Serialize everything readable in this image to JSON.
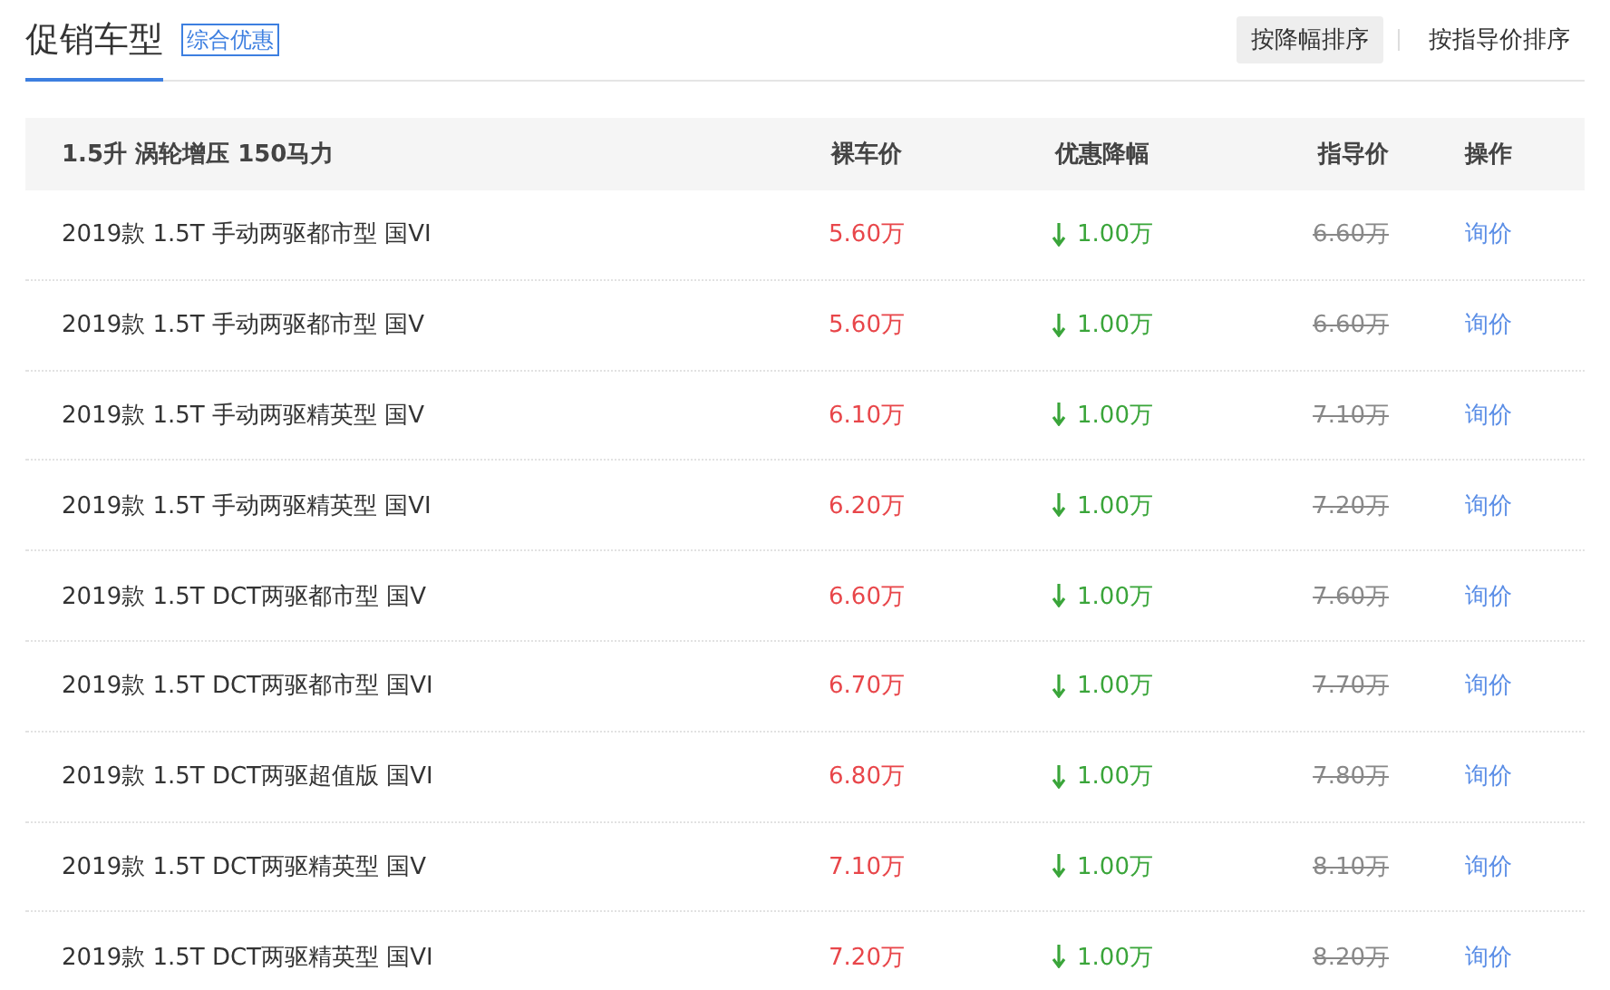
{
  "header": {
    "title": "促销车型",
    "tag": "综合优惠",
    "sort_buttons": [
      {
        "label": "按降幅排序",
        "selected": true
      },
      {
        "label": "按指导价排序",
        "selected": false
      }
    ]
  },
  "table": {
    "columns": [
      "1.5升 涡轮增压 150马力",
      "裸车价",
      "优惠降幅",
      "指导价",
      "操作"
    ],
    "rows": [
      {
        "name": "2019款 1.5T 手动两驱都市型 国VI",
        "price": "5.60万",
        "discount": "1.00万",
        "guide_price": "6.60万",
        "action": "询价"
      },
      {
        "name": "2019款 1.5T 手动两驱都市型 国V",
        "price": "5.60万",
        "discount": "1.00万",
        "guide_price": "6.60万",
        "action": "询价"
      },
      {
        "name": "2019款 1.5T 手动两驱精英型 国V",
        "price": "6.10万",
        "discount": "1.00万",
        "guide_price": "7.10万",
        "action": "询价"
      },
      {
        "name": "2019款 1.5T 手动两驱精英型 国VI",
        "price": "6.20万",
        "discount": "1.00万",
        "guide_price": "7.20万",
        "action": "询价"
      },
      {
        "name": "2019款 1.5T DCT两驱都市型 国V",
        "price": "6.60万",
        "discount": "1.00万",
        "guide_price": "7.60万",
        "action": "询价"
      },
      {
        "name": "2019款 1.5T DCT两驱都市型 国VI",
        "price": "6.70万",
        "discount": "1.00万",
        "guide_price": "7.70万",
        "action": "询价"
      },
      {
        "name": "2019款 1.5T DCT两驱超值版 国VI",
        "price": "6.80万",
        "discount": "1.00万",
        "guide_price": "7.80万",
        "action": "询价"
      },
      {
        "name": "2019款 1.5T DCT两驱精英型 国V",
        "price": "7.10万",
        "discount": "1.00万",
        "guide_price": "8.10万",
        "action": "询价"
      },
      {
        "name": "2019款 1.5T DCT两驱精英型 国VI",
        "price": "7.20万",
        "discount": "1.00万",
        "guide_price": "8.20万",
        "action": "询价"
      }
    ]
  }
}
